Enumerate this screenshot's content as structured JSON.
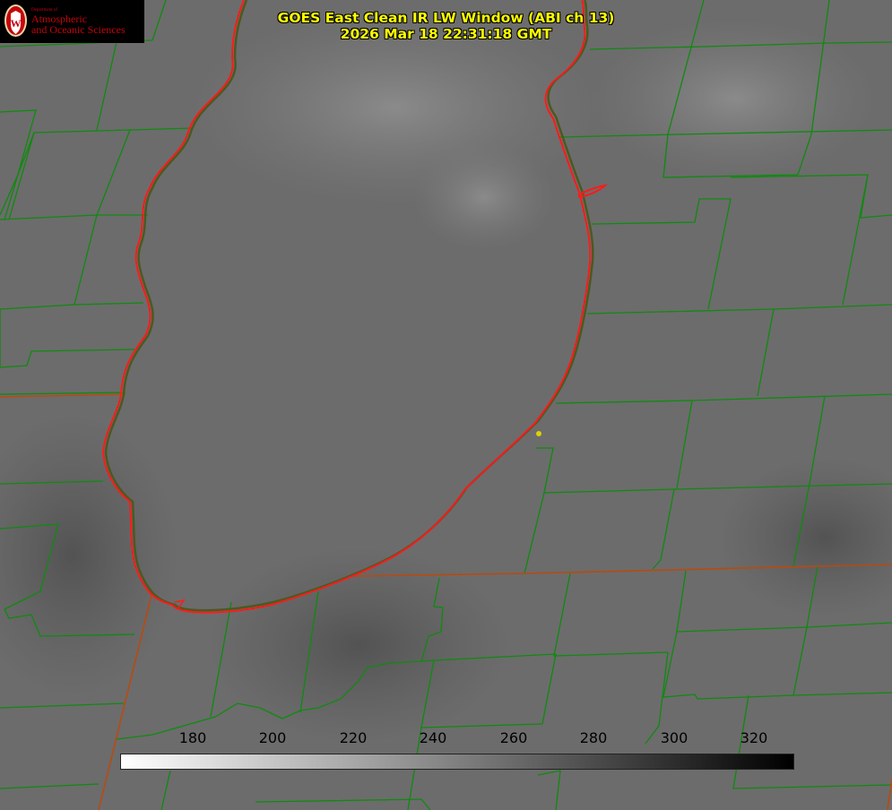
{
  "title": {
    "line1": "GOES East Clean IR LW Window (ABI ch 13)",
    "line2": "2026 Mar 18 22:31:18 GMT"
  },
  "logo": {
    "department": "Department of",
    "line1": "Atmospheric",
    "line2": "and Oceanic Sciences",
    "seal_letter": "W",
    "color": "#c5050c"
  },
  "colorbar": {
    "ticks": [
      "180",
      "200",
      "220",
      "240",
      "260",
      "280",
      "300",
      "320"
    ],
    "range": [
      162,
      332
    ],
    "start_color": "#ffffff",
    "end_color": "#000000"
  },
  "map": {
    "lake_outline_color": "#ff1a1a",
    "county_border_color": "#0f8a0f",
    "state_border_color": "#b84a10",
    "marker_color": "#e0d000"
  }
}
